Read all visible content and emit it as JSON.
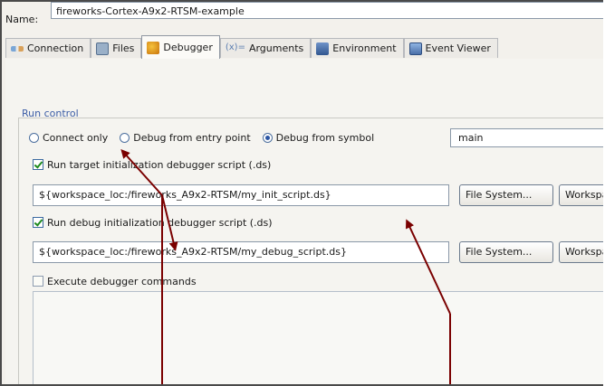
{
  "name_row": {
    "label": "Name:",
    "value": "fireworks-Cortex-A9x2-RTSM-example"
  },
  "tabs": [
    {
      "label": "Connection",
      "icon": "connection-icon",
      "active": false
    },
    {
      "label": "Files",
      "icon": "files-icon",
      "active": false
    },
    {
      "label": "Debugger",
      "icon": "debugger-icon",
      "active": true
    },
    {
      "label": "Arguments",
      "icon": "arguments-icon",
      "active": false
    },
    {
      "label": "Environment",
      "icon": "environment-icon",
      "active": false
    },
    {
      "label": "Event Viewer",
      "icon": "event-viewer-icon",
      "active": false
    }
  ],
  "run_control": {
    "title": "Run control",
    "radios": [
      {
        "label": "Connect only",
        "selected": false
      },
      {
        "label": "Debug from entry point",
        "selected": false
      },
      {
        "label": "Debug from symbol",
        "selected": true
      }
    ],
    "symbol_value": "main",
    "target_init": {
      "checked": true,
      "label": "Run target initialization debugger script (.ds)",
      "path": "${workspace_loc:/fireworks_A9x2-RTSM/my_init_script.ds}"
    },
    "debug_init": {
      "checked": true,
      "label": "Run debug initialization debugger script (.ds)",
      "path": "${workspace_loc:/fireworks_A9x2-RTSM/my_debug_script.ds}"
    },
    "execute_cmds": {
      "checked": false,
      "label": "Execute debugger commands"
    },
    "buttons": {
      "file_system": "File System...",
      "workspace": "Workspace..."
    }
  },
  "colors": {
    "section_title": "#3c5da6",
    "arrow": "#7a0000",
    "frame_border": "#4a4a4a"
  }
}
